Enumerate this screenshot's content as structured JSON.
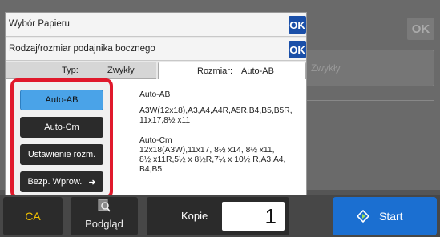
{
  "background": {
    "ghost_ok": "OK",
    "ghost_text_1": "Zwykły"
  },
  "dialog": {
    "title": "Wybór Papieru",
    "title_ok": "OK",
    "subtitle": "Rodzaj/rozmiar podajnika bocznego",
    "subtitle_ok": "OK",
    "tabs": {
      "type_label": "Typ:",
      "type_value": "Zwykły",
      "size_label": "Rozmiar:",
      "size_value": "Auto-AB"
    },
    "side_buttons": {
      "auto_ab": "Auto-AB",
      "auto_cm": "Auto-Cm",
      "custom_size": "Ustawienie rozm.",
      "direct_entry": "Bezp. Wprow."
    },
    "descriptions": {
      "auto_ab_title": "Auto-AB",
      "auto_ab_line1": "A3W(12x18),A3,A4,A4R,A5R,B4,B5,B5R,",
      "auto_ab_line2": "11x17,8½ x11",
      "auto_cm_title": "Auto-Cm",
      "auto_cm_line1": "12x18(A3W),11x17, 8½ x14, 8½ x11,",
      "auto_cm_line2": "8½ x11R,5½ x 8½R,7¼ x 10½ R,A3,A4,",
      "auto_cm_line3": "B4,B5"
    }
  },
  "bottom_bar": {
    "ca": "CA",
    "preview": "Podgląd",
    "copies_label": "Kopie",
    "copies_value": "1",
    "start": "Start"
  },
  "colors": {
    "accent_blue": "#1a4fa8",
    "selected_blue": "#4aa3e8",
    "highlight_red": "#e0192c",
    "start_blue": "#1b6fd1",
    "ca_yellow": "#f2c200"
  }
}
